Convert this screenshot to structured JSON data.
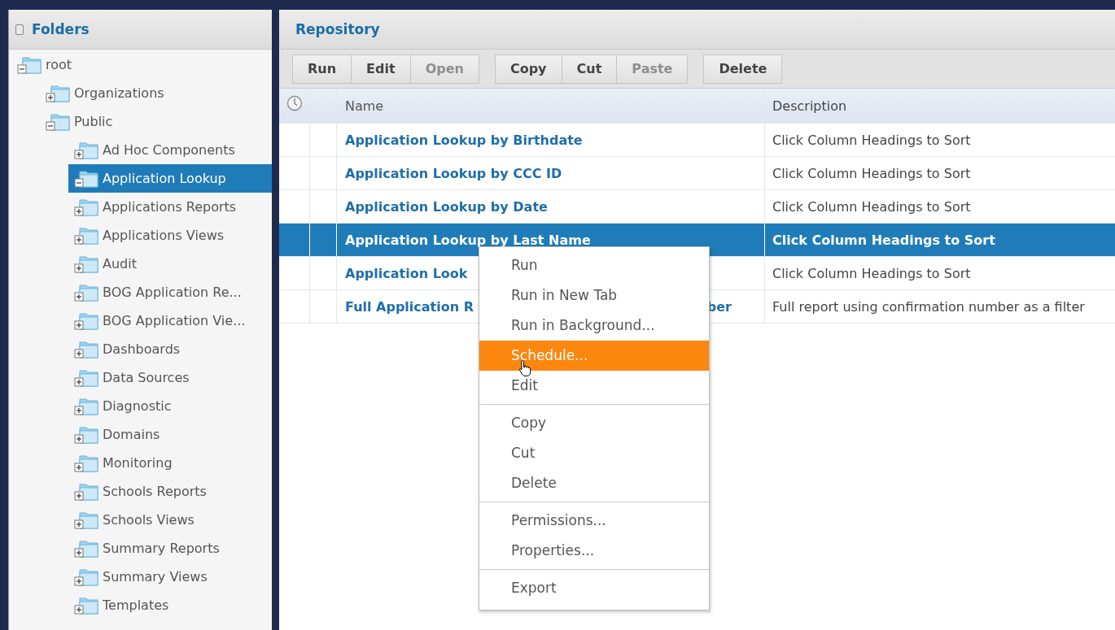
{
  "folders_panel": {
    "title": "Folders",
    "tree": [
      {
        "label": "root",
        "expanded": true,
        "selected": false,
        "children": [
          {
            "label": "Organizations",
            "expanded": false,
            "selected": false
          },
          {
            "label": "Public",
            "expanded": true,
            "selected": false,
            "children": [
              {
                "label": "Ad Hoc Components",
                "expanded": false,
                "selected": false
              },
              {
                "label": "Application Lookup",
                "expanded": true,
                "selected": true
              },
              {
                "label": "Applications Reports",
                "expanded": false,
                "selected": false
              },
              {
                "label": "Applications Views",
                "expanded": false,
                "selected": false
              },
              {
                "label": "Audit",
                "expanded": false,
                "selected": false
              },
              {
                "label": "BOG Application Re...",
                "expanded": false,
                "selected": false
              },
              {
                "label": "BOG Application Vie...",
                "expanded": false,
                "selected": false
              },
              {
                "label": "Dashboards",
                "expanded": false,
                "selected": false
              },
              {
                "label": "Data Sources",
                "expanded": false,
                "selected": false
              },
              {
                "label": "Diagnostic",
                "expanded": false,
                "selected": false
              },
              {
                "label": "Domains",
                "expanded": false,
                "selected": false
              },
              {
                "label": "Monitoring",
                "expanded": false,
                "selected": false
              },
              {
                "label": "Schools Reports",
                "expanded": false,
                "selected": false
              },
              {
                "label": "Schools Views",
                "expanded": false,
                "selected": false
              },
              {
                "label": "Summary Reports",
                "expanded": false,
                "selected": false
              },
              {
                "label": "Summary Views",
                "expanded": false,
                "selected": false
              },
              {
                "label": "Templates",
                "expanded": false,
                "selected": false
              }
            ]
          }
        ]
      }
    ]
  },
  "repository": {
    "title": "Repository",
    "toolbar": [
      [
        {
          "label": "Run",
          "disabled": false
        },
        {
          "label": "Edit",
          "disabled": false
        },
        {
          "label": "Open",
          "disabled": true
        }
      ],
      [
        {
          "label": "Copy",
          "disabled": false
        },
        {
          "label": "Cut",
          "disabled": false
        },
        {
          "label": "Paste",
          "disabled": true
        }
      ],
      [
        {
          "label": "Delete",
          "disabled": false
        }
      ]
    ],
    "table": {
      "columns": [
        "Name",
        "Description"
      ],
      "rows": [
        {
          "name": "Application Lookup by Birthdate",
          "description": "Click Column Headings to Sort",
          "selected": false
        },
        {
          "name": "Application Lookup by CCC ID",
          "description": "Click Column Headings to Sort",
          "selected": false
        },
        {
          "name": "Application Lookup by Date",
          "description": "Click Column Headings to Sort",
          "selected": false
        },
        {
          "name": "Application Lookup by Last Name",
          "description": "Click Column Headings to Sort",
          "selected": true
        },
        {
          "name": "Application Look",
          "description": "Click Column Headings to Sort",
          "selected": false
        },
        {
          "name": "Full Application R",
          "name_end": "ber",
          "description": "Full report using confirmation number as a filter",
          "selected": false
        }
      ]
    }
  },
  "context_menu": [
    [
      {
        "label": "Run",
        "selected": false
      },
      {
        "label": "Run in New Tab",
        "selected": false
      },
      {
        "label": "Run in Background...",
        "selected": false
      },
      {
        "label": "Schedule...",
        "selected": true
      },
      {
        "label": "Edit",
        "selected": false
      }
    ],
    [
      {
        "label": "Copy",
        "selected": false
      },
      {
        "label": "Cut",
        "selected": false
      },
      {
        "label": "Delete",
        "selected": false
      }
    ],
    [
      {
        "label": "Permissions...",
        "selected": false
      },
      {
        "label": "Properties...",
        "selected": false
      }
    ],
    [
      {
        "label": "Export",
        "selected": false
      }
    ]
  ]
}
